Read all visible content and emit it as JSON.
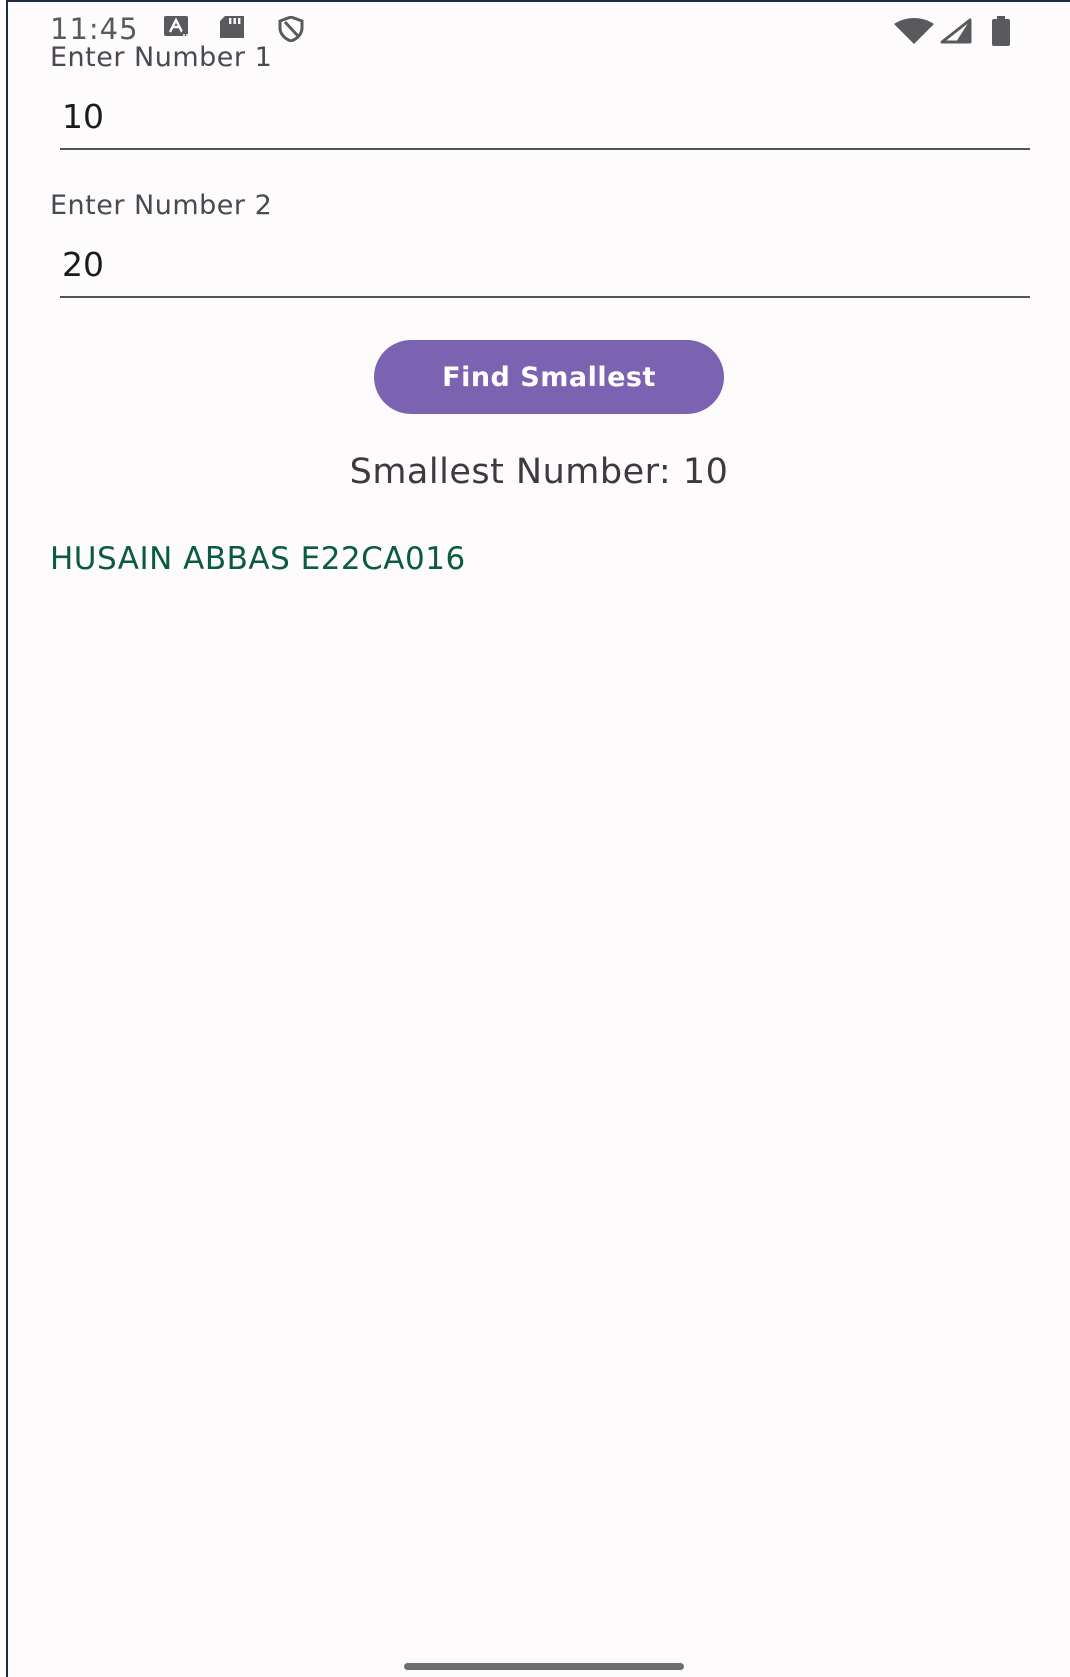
{
  "status_bar": {
    "time": "11:45",
    "left_icons": [
      "accessibility-icon",
      "sd-card-icon",
      "vpn-shield-icon"
    ],
    "right_icons": [
      "wifi-icon",
      "cell-signal-icon",
      "battery-icon"
    ]
  },
  "form": {
    "field1": {
      "label": "Enter Number 1",
      "value": "10"
    },
    "field2": {
      "label": "Enter Number 2",
      "value": "20"
    },
    "button_label": "Find Smallest"
  },
  "result": {
    "text": "Smallest Number: 10"
  },
  "author": {
    "text": "HUSAIN ABBAS E22CA016"
  },
  "colors": {
    "background": "#fefbfd",
    "button": "#7b63b2",
    "button_text": "#ffffff",
    "author_text": "#0a5a44",
    "underline": "#55535a"
  }
}
